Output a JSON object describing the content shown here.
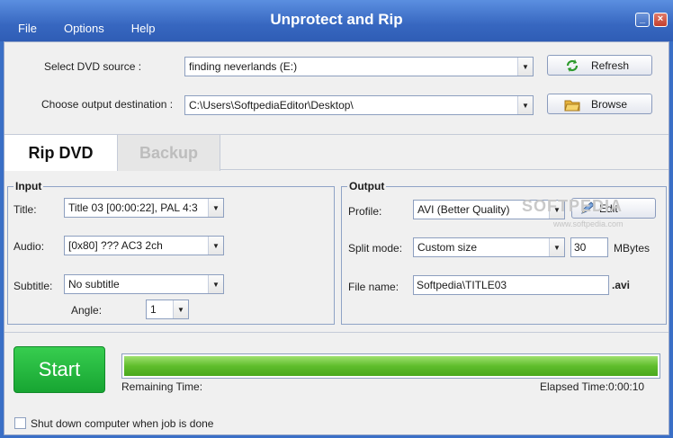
{
  "window": {
    "title": "Unprotect and Rip",
    "minimize": "_",
    "close": "×"
  },
  "menu": [
    "File",
    "Options",
    "Help"
  ],
  "source": {
    "label": "Select DVD source :",
    "value": "finding neverlands (E:)",
    "button": "Refresh"
  },
  "destination": {
    "label": "Choose output destination :",
    "value": "C:\\Users\\SoftpediaEditor\\Desktop\\",
    "button": "Browse"
  },
  "tabs": [
    "Rip DVD",
    "Backup"
  ],
  "input": {
    "title": "Input",
    "title_label": "Title:",
    "title_value": "Title 03 [00:00:22], PAL 4:3",
    "audio_label": "Audio:",
    "audio_value": "[0x80] ??? AC3 2ch",
    "subtitle_label": "Subtitle:",
    "subtitle_value": "No subtitle",
    "angle_label": "Angle:",
    "angle_value": "1"
  },
  "output": {
    "title": "Output",
    "profile_label": "Profile:",
    "profile_value": "AVI (Better Quality)",
    "edit_button": "Edit",
    "split_label": "Split mode:",
    "split_value": "Custom size",
    "split_size": "30",
    "split_unit": "MBytes",
    "filename_label": "File name:",
    "filename_value": "Softpedia\\TITLE03",
    "extension": ".avi"
  },
  "start_button": "Start",
  "progress": {
    "fraction": 1.0,
    "remaining_label": "Remaining Time:",
    "elapsed_label": "Elapsed Time:0:00:10"
  },
  "shutdown_label": "Shut down computer when job is done",
  "watermark": {
    "main": "SOFTPEDIA",
    "url": "www.softpedia.com"
  }
}
